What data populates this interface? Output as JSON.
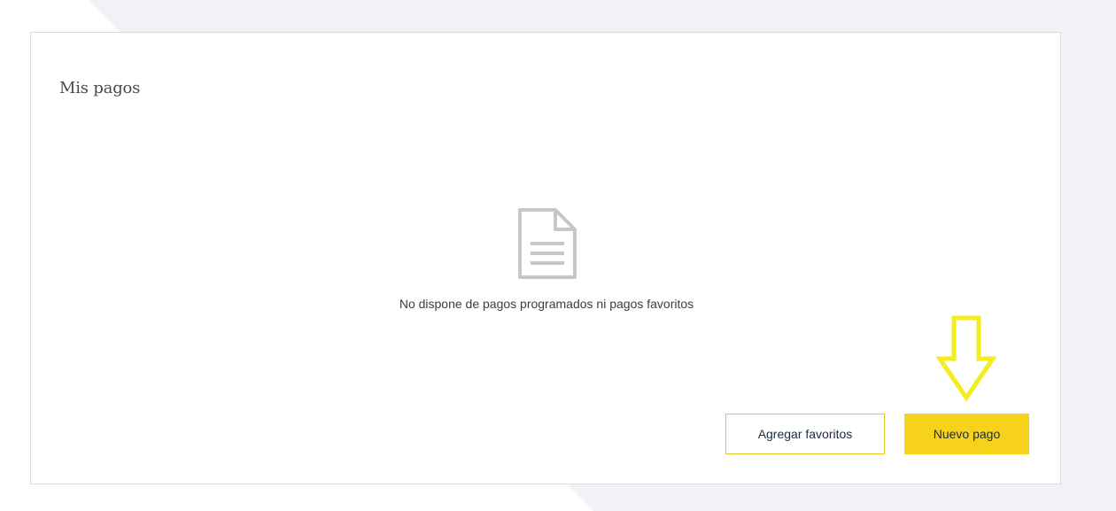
{
  "card": {
    "title": "Mis pagos"
  },
  "empty_state": {
    "icon": "document-icon",
    "message": "No dispone de pagos programados ni pagos favoritos"
  },
  "actions": {
    "add_favorites_label": "Agregar favoritos",
    "new_payment_label": "Nuevo pago"
  },
  "annotation": {
    "icon": "down-arrow-icon",
    "color": "#f4ec1c"
  },
  "colors": {
    "primary_button": "#f7d21a",
    "secondary_border": "#e6c81e",
    "background_shape": "#f1f2f5"
  }
}
